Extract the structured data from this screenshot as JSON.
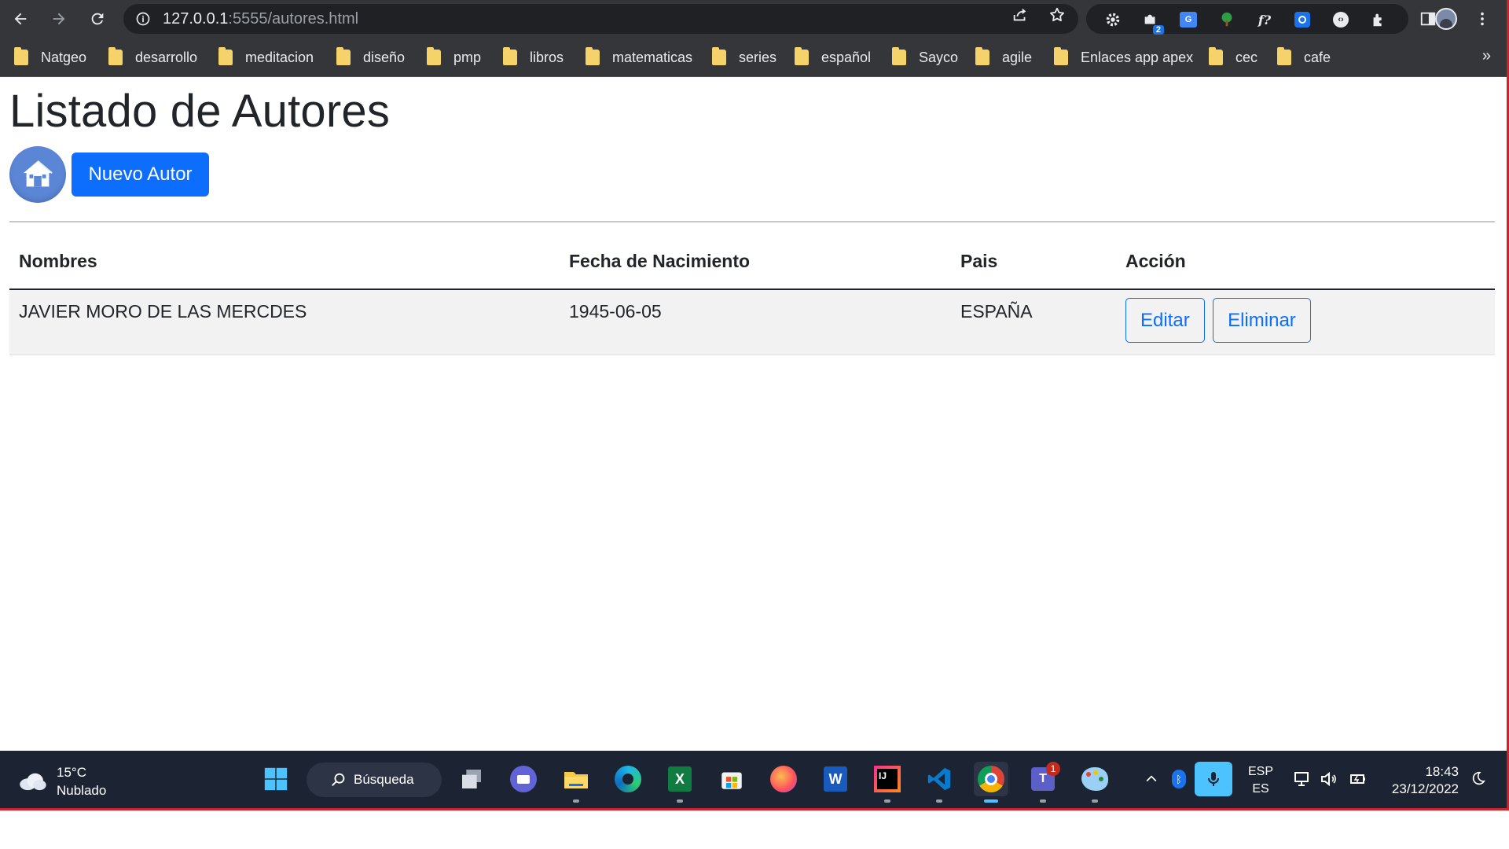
{
  "browser": {
    "url_host": "127.0.0.1",
    "url_path": ":5555/autores.html",
    "bookmarks": [
      "Natgeo",
      "desarrollo",
      "meditacion",
      "diseño",
      "pmp",
      "libros",
      "matematicas",
      "series",
      "español",
      "Sayco",
      "agile",
      "Enlaces app apex",
      "cec",
      "cafe"
    ],
    "more_bookmarks": "»",
    "extension_badge": "2"
  },
  "page": {
    "title": "Listado de Autores",
    "new_button": "Nuevo Autor",
    "table": {
      "headers": [
        "Nombres",
        "Fecha de Nacimiento",
        "Pais",
        "Acción"
      ],
      "rows": [
        {
          "name": "JAVIER MORO DE LAS MERCDES",
          "birth_date": "1945-06-05",
          "country": "ESPAÑA",
          "edit": "Editar",
          "delete": "Eliminar"
        }
      ]
    }
  },
  "taskbar": {
    "weather_temp": "15°C",
    "weather_desc": "Nublado",
    "search_label": "Búsqueda",
    "teams_badge": "1",
    "lang_line1": "ESP",
    "lang_line2": "ES",
    "time": "18:43",
    "date": "23/12/2022"
  },
  "colors": {
    "primary": "#0d6efd",
    "chrome_bar": "#35363a",
    "taskbar": "#1c2433"
  }
}
